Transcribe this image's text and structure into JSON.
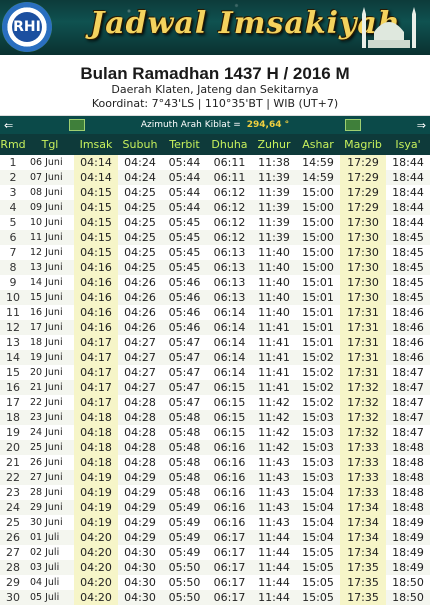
{
  "banner": {
    "logo_text": "RHI",
    "title": "Jadwal Imsakiyah"
  },
  "header": {
    "month_title": "Bulan Ramadhan 1437 H / 2016 M",
    "region": "Daerah Klaten, Jateng dan Sekitarnya",
    "coordinates": "Koordinat: 7°43'LS | 110°35'BT | WIB (UT+7)"
  },
  "qibla": {
    "label": "Azimuth Arah Kiblat = ",
    "value": "294,64 °",
    "prev": "⇐",
    "next": "⇒"
  },
  "colors": {
    "header_bg": "#0e3a3a",
    "header_text": "#c7f05c",
    "highlight": "#f6f5c8",
    "banner_title": "#f4d35e"
  },
  "table": {
    "columns": [
      "Rmd",
      "Tgl",
      "Imsak",
      "Subuh",
      "Terbit",
      "Dhuha",
      "Zuhur",
      "Ashar",
      "Magrib",
      "Isya'"
    ],
    "rows": [
      [
        "1",
        "06 Juni",
        "04:14",
        "04:24",
        "05:44",
        "06:11",
        "11:38",
        "14:59",
        "17:29",
        "18:44"
      ],
      [
        "2",
        "07 Juni",
        "04:14",
        "04:24",
        "05:44",
        "06:11",
        "11:39",
        "14:59",
        "17:29",
        "18:44"
      ],
      [
        "3",
        "08 Juni",
        "04:15",
        "04:25",
        "05:44",
        "06:12",
        "11:39",
        "15:00",
        "17:29",
        "18:44"
      ],
      [
        "4",
        "09 Juni",
        "04:15",
        "04:25",
        "05:44",
        "06:12",
        "11:39",
        "15:00",
        "17:29",
        "18:44"
      ],
      [
        "5",
        "10 Juni",
        "04:15",
        "04:25",
        "05:45",
        "06:12",
        "11:39",
        "15:00",
        "17:30",
        "18:44"
      ],
      [
        "6",
        "11 Juni",
        "04:15",
        "04:25",
        "05:45",
        "06:12",
        "11:39",
        "15:00",
        "17:30",
        "18:45"
      ],
      [
        "7",
        "12 Juni",
        "04:15",
        "04:25",
        "05:45",
        "06:13",
        "11:40",
        "15:00",
        "17:30",
        "18:45"
      ],
      [
        "8",
        "13 Juni",
        "04:16",
        "04:25",
        "05:45",
        "06:13",
        "11:40",
        "15:00",
        "17:30",
        "18:45"
      ],
      [
        "9",
        "14 Juni",
        "04:16",
        "04:26",
        "05:46",
        "06:13",
        "11:40",
        "15:01",
        "17:30",
        "18:45"
      ],
      [
        "10",
        "15 Juni",
        "04:16",
        "04:26",
        "05:46",
        "06:13",
        "11:40",
        "15:01",
        "17:30",
        "18:45"
      ],
      [
        "11",
        "16 Juni",
        "04:16",
        "04:26",
        "05:46",
        "06:14",
        "11:40",
        "15:01",
        "17:31",
        "18:46"
      ],
      [
        "12",
        "17 Juni",
        "04:16",
        "04:26",
        "05:46",
        "06:14",
        "11:41",
        "15:01",
        "17:31",
        "18:46"
      ],
      [
        "13",
        "18 Juni",
        "04:17",
        "04:27",
        "05:47",
        "06:14",
        "11:41",
        "15:01",
        "17:31",
        "18:46"
      ],
      [
        "14",
        "19 Juni",
        "04:17",
        "04:27",
        "05:47",
        "06:14",
        "11:41",
        "15:02",
        "17:31",
        "18:46"
      ],
      [
        "15",
        "20 Juni",
        "04:17",
        "04:27",
        "05:47",
        "06:14",
        "11:41",
        "15:02",
        "17:31",
        "18:47"
      ],
      [
        "16",
        "21 Juni",
        "04:17",
        "04:27",
        "05:47",
        "06:15",
        "11:41",
        "15:02",
        "17:32",
        "18:47"
      ],
      [
        "17",
        "22 Juni",
        "04:17",
        "04:28",
        "05:47",
        "06:15",
        "11:42",
        "15:02",
        "17:32",
        "18:47"
      ],
      [
        "18",
        "23 Juni",
        "04:18",
        "04:28",
        "05:48",
        "06:15",
        "11:42",
        "15:03",
        "17:32",
        "18:47"
      ],
      [
        "19",
        "24 Juni",
        "04:18",
        "04:28",
        "05:48",
        "06:15",
        "11:42",
        "15:03",
        "17:32",
        "18:47"
      ],
      [
        "20",
        "25 Juni",
        "04:18",
        "04:28",
        "05:48",
        "06:16",
        "11:42",
        "15:03",
        "17:33",
        "18:48"
      ],
      [
        "21",
        "26 Juni",
        "04:18",
        "04:28",
        "05:48",
        "06:16",
        "11:43",
        "15:03",
        "17:33",
        "18:48"
      ],
      [
        "22",
        "27 Juni",
        "04:19",
        "04:29",
        "05:48",
        "06:16",
        "11:43",
        "15:03",
        "17:33",
        "18:48"
      ],
      [
        "23",
        "28 Juni",
        "04:19",
        "04:29",
        "05:48",
        "06:16",
        "11:43",
        "15:04",
        "17:33",
        "18:48"
      ],
      [
        "24",
        "29 Juni",
        "04:19",
        "04:29",
        "05:49",
        "06:16",
        "11:43",
        "15:04",
        "17:34",
        "18:48"
      ],
      [
        "25",
        "30 Juni",
        "04:19",
        "04:29",
        "05:49",
        "06:16",
        "11:43",
        "15:04",
        "17:34",
        "18:49"
      ],
      [
        "26",
        "01 Juli",
        "04:20",
        "04:29",
        "05:49",
        "06:17",
        "11:44",
        "15:04",
        "17:34",
        "18:49"
      ],
      [
        "27",
        "02 Juli",
        "04:20",
        "04:30",
        "05:49",
        "06:17",
        "11:44",
        "15:05",
        "17:34",
        "18:49"
      ],
      [
        "28",
        "03 Juli",
        "04:20",
        "04:30",
        "05:50",
        "06:17",
        "11:44",
        "15:05",
        "17:35",
        "18:49"
      ],
      [
        "29",
        "04 Juli",
        "04:20",
        "04:30",
        "05:50",
        "06:17",
        "11:44",
        "15:05",
        "17:35",
        "18:50"
      ],
      [
        "30",
        "05 Juli",
        "04:20",
        "04:30",
        "05:50",
        "06:17",
        "11:44",
        "15:05",
        "17:35",
        "18:50"
      ]
    ]
  }
}
